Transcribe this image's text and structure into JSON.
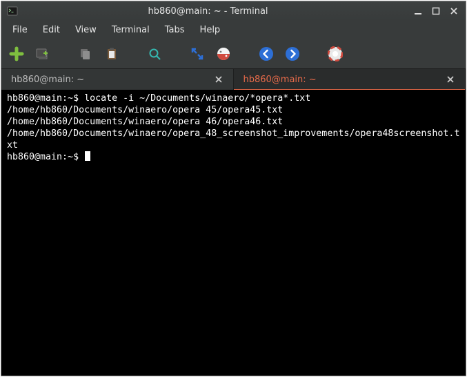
{
  "window": {
    "title": "hb860@main: ~ - Terminal"
  },
  "menu": {
    "items": [
      "File",
      "Edit",
      "View",
      "Terminal",
      "Tabs",
      "Help"
    ]
  },
  "tabs": {
    "items": [
      {
        "label": "hb860@main: ~",
        "active": false
      },
      {
        "label": "hb860@main: ~",
        "active": true
      }
    ]
  },
  "terminal": {
    "prompt": "hb860@main:~$",
    "lines": [
      {
        "type": "cmd",
        "text": "locate -i ~/Documents/winaero/*opera*.txt"
      },
      {
        "type": "out",
        "text": "/home/hb860/Documents/winaero/opera 45/opera45.txt"
      },
      {
        "type": "out",
        "text": "/home/hb860/Documents/winaero/opera 46/opera46.txt"
      },
      {
        "type": "out",
        "text": "/home/hb860/Documents/winaero/opera_48_screenshot_improvements/opera48screenshot.txt"
      },
      {
        "type": "prompt"
      }
    ]
  }
}
